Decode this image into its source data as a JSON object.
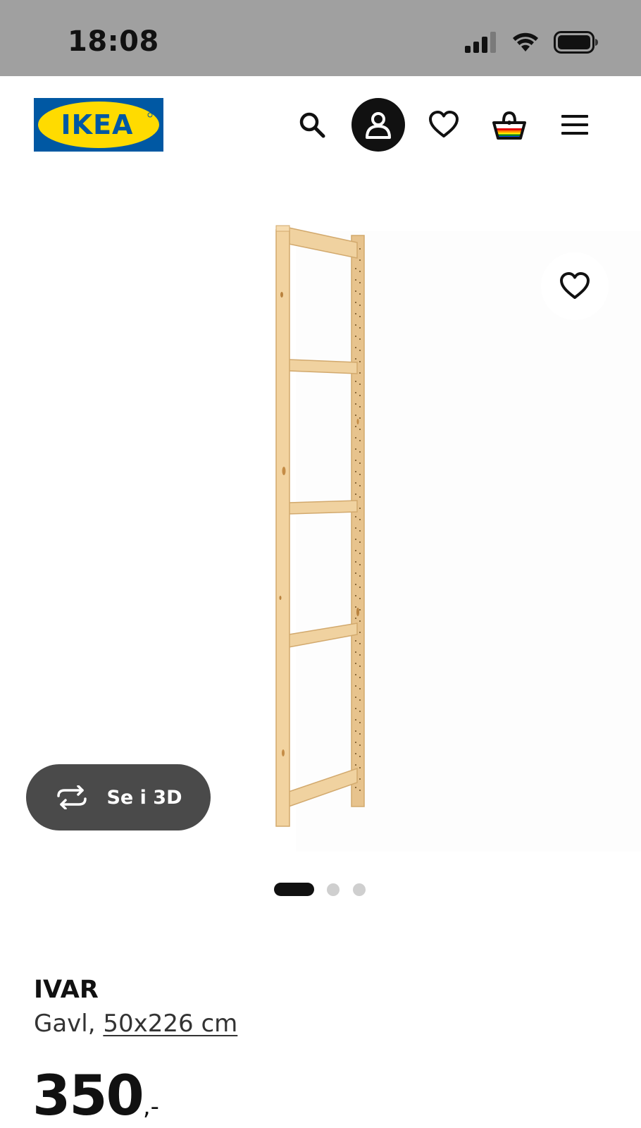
{
  "status_bar": {
    "time": "18:08"
  },
  "header": {
    "logo_text": "IKEA",
    "brand_colors": {
      "blue": "#0058A3",
      "yellow": "#FFDB00"
    },
    "icons": [
      "search-icon",
      "profile-icon",
      "heart-icon",
      "basket-icon",
      "menu-icon"
    ]
  },
  "gallery": {
    "view_3d_label": "Se i 3D",
    "slide_count": 3,
    "active_slide": 1
  },
  "product": {
    "name": "IVAR",
    "type": "Gavl,",
    "size": "50x226 cm",
    "price_integer": "350",
    "price_suffix": ",-"
  }
}
